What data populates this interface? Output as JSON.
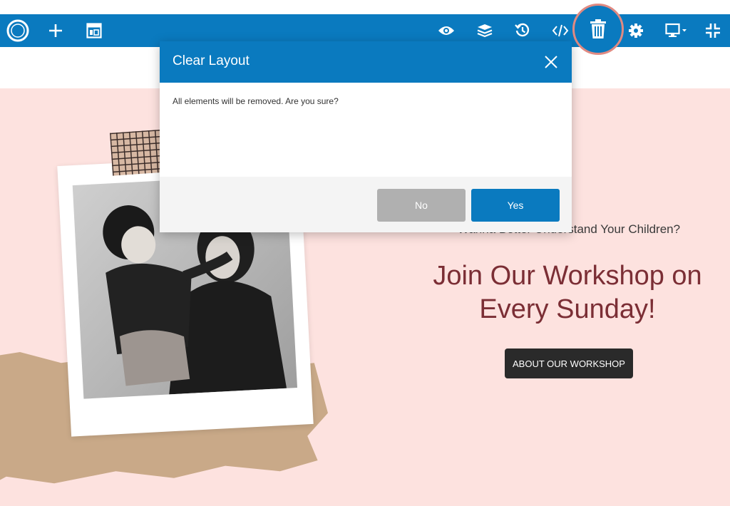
{
  "toolbar": {
    "left_icons": [
      "logo-icon",
      "plus-icon",
      "layout-icon"
    ],
    "right_icons": [
      "eye-icon",
      "layers-icon",
      "history-icon",
      "code-icon",
      "trash-icon",
      "gear-icon",
      "monitor-icon",
      "compress-icon"
    ],
    "accent": "#0a7abf",
    "highlight_ring": "#e08a82"
  },
  "modal": {
    "title": "Clear Layout",
    "message": "All elements will be removed. Are you sure?",
    "no_label": "No",
    "yes_label": "Yes"
  },
  "canvas": {
    "subtitle": "Wanna Better Understand Your Children?",
    "headline_line1": "Join Our Workshop on",
    "headline_line2": "Every Sunday!",
    "cta_label": "ABOUT OUR WORKSHOP",
    "background": "#fde2df",
    "headline_color": "#7b2e35"
  }
}
